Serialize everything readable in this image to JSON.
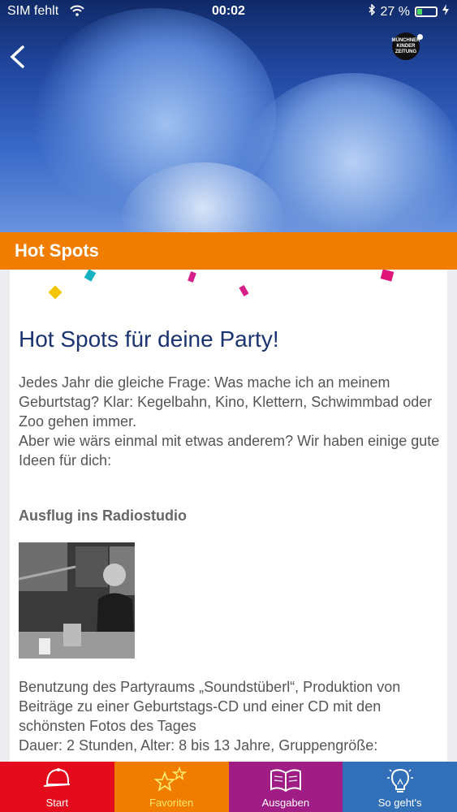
{
  "status": {
    "carrier": "SIM fehlt",
    "time": "00:02",
    "battery": "27 %"
  },
  "header": {
    "logo_text": "MÜNCHNER KINDER ZEITUNG"
  },
  "section": {
    "title": "Hot Spots"
  },
  "article": {
    "title": "Hot Spots für deine Party!",
    "intro_1": "Jedes Jahr die gleiche Frage: Was mache ich an meinem Geburtstag? Klar: Kegelbahn, Kino, Klettern, Schwimmbad oder Zoo gehen immer.",
    "intro_2": "Aber wie wärs einmal mit etwas anderem? Wir haben einige gute Ideen für dich:",
    "subheading": "Ausflug ins Radiostudio",
    "desc_1": "Benutzung des Partyraums „Soundstüberl“, Produktion von Beiträge zu einer Geburtstags-CD und einer CD mit den schönsten Fotos des Tages",
    "desc_2": "Dauer: 2 Stunden, Alter: 8 bis 13 Jahre, Gruppengröße:"
  },
  "tabs": [
    {
      "label": "Start",
      "icon": "cap-icon"
    },
    {
      "label": "Favoriten",
      "icon": "stars-icon"
    },
    {
      "label": "Ausgaben",
      "icon": "book-icon"
    },
    {
      "label": "So geht's",
      "icon": "lightbulb-icon"
    }
  ]
}
